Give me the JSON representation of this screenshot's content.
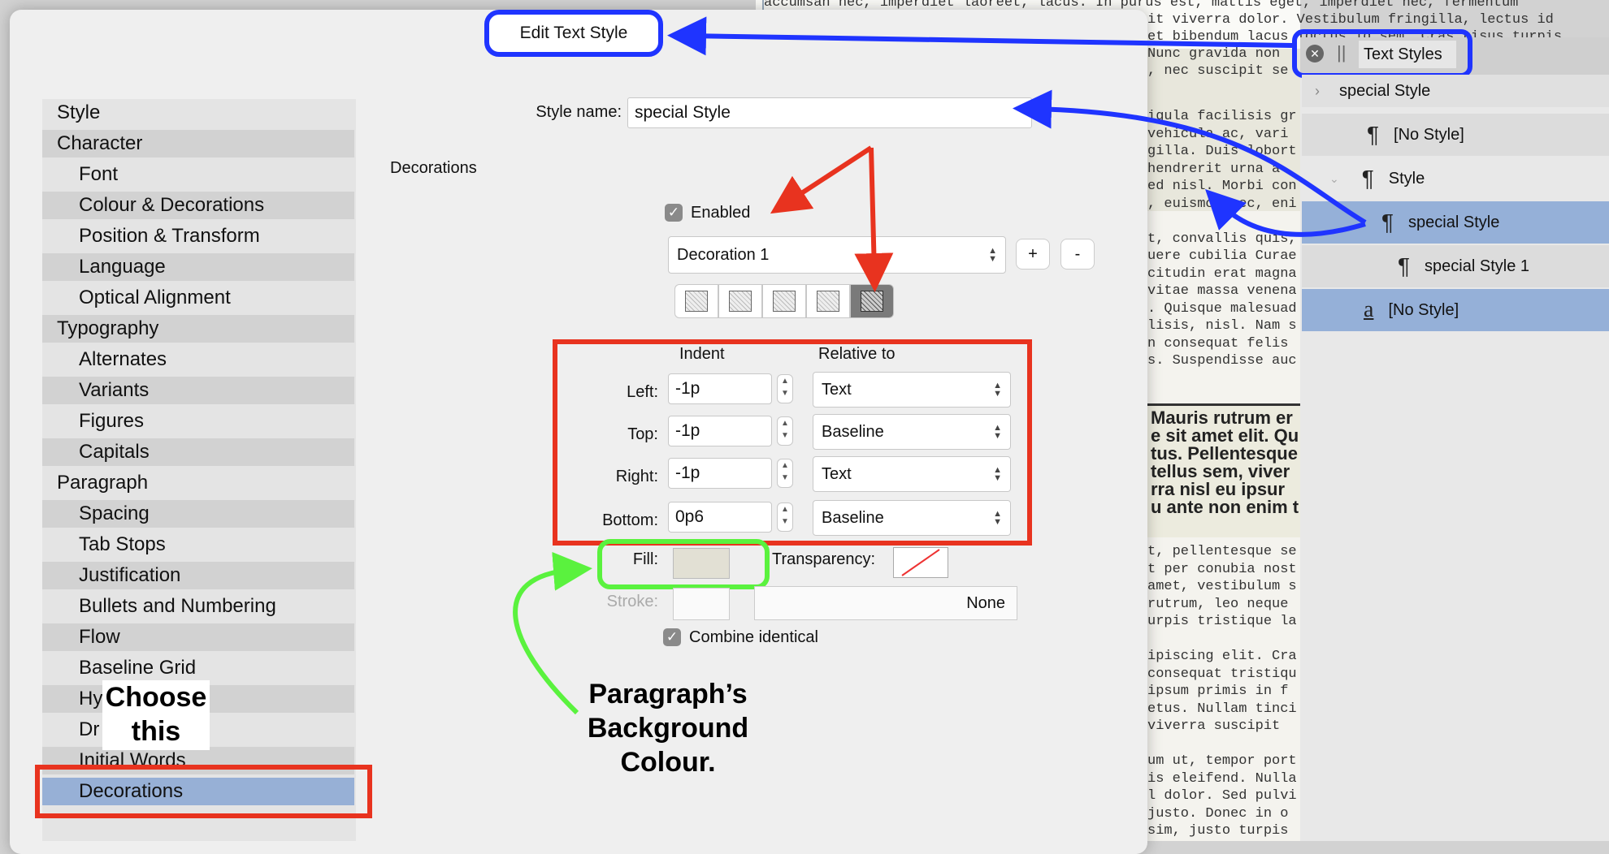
{
  "dialog_title": "Edit Text Style",
  "sidebar": {
    "items": [
      {
        "label": "Style",
        "level": 0
      },
      {
        "label": "Character",
        "level": 0
      },
      {
        "label": "Font",
        "level": 1
      },
      {
        "label": "Colour & Decorations",
        "level": 1
      },
      {
        "label": "Position & Transform",
        "level": 1
      },
      {
        "label": "Language",
        "level": 1
      },
      {
        "label": "Optical Alignment",
        "level": 1
      },
      {
        "label": "Typography",
        "level": 0
      },
      {
        "label": "Alternates",
        "level": 1
      },
      {
        "label": "Variants",
        "level": 1
      },
      {
        "label": "Figures",
        "level": 1
      },
      {
        "label": "Capitals",
        "level": 1
      },
      {
        "label": "Paragraph",
        "level": 0
      },
      {
        "label": "Spacing",
        "level": 1
      },
      {
        "label": "Tab Stops",
        "level": 1
      },
      {
        "label": "Justification",
        "level": 1
      },
      {
        "label": "Bullets and Numbering",
        "level": 1
      },
      {
        "label": "Flow",
        "level": 1
      },
      {
        "label": "Baseline Grid",
        "level": 1
      },
      {
        "label": "Hy",
        "level": 1
      },
      {
        "label": "Dr",
        "level": 1
      },
      {
        "label": "Initial Words",
        "level": 1
      },
      {
        "label": "Decorations",
        "level": 1,
        "selected": true
      }
    ]
  },
  "form": {
    "style_name_label": "Style name:",
    "style_name_value": "special Style",
    "section_label": "Decorations",
    "enabled_label": "Enabled",
    "decoration_select": "Decoration 1",
    "add_label": "+",
    "remove_label": "-",
    "indent_header": "Indent",
    "relative_header": "Relative to",
    "rows": [
      {
        "label": "Left:",
        "indent": "-1p",
        "relative": "Text"
      },
      {
        "label": "Top:",
        "indent": "-1p",
        "relative": "Baseline"
      },
      {
        "label": "Right:",
        "indent": "-1p",
        "relative": "Text"
      },
      {
        "label": "Bottom:",
        "indent": "0p6",
        "relative": "Baseline"
      }
    ],
    "fill_label": "Fill:",
    "transparency_label": "Transparency:",
    "stroke_label": "Stroke:",
    "stroke_value": "None",
    "combine_label": "Combine identical"
  },
  "annotations": {
    "choose_this": "Choose this",
    "paragraph_bg": "Paragraph’s Background Colour."
  },
  "right_panel": {
    "tab_title": "Text Styles",
    "items": [
      {
        "label": "special Style",
        "kind": "header"
      },
      {
        "label": "[No Style]",
        "kind": "para"
      },
      {
        "label": "Style",
        "kind": "para"
      },
      {
        "label": "special Style",
        "kind": "para",
        "selected": true
      },
      {
        "label": "special Style 1",
        "kind": "para"
      },
      {
        "label": "[No Style]",
        "kind": "char",
        "selected": true
      }
    ]
  },
  "document": {
    "top_lines": [
      "accumsan nec, imperdiet laoreet, lacus. In purus est, mattis eget, imperdiet nec, fermentum",
      "it viverra dolor. Vestibulum fringilla, lectus id",
      "et bibendum lacus loctus id sem. Cras risus turpis",
      "Nunc gravida non",
      ", nec suscipit se"
    ],
    "col_lines": [
      "igula facilisis gr",
      " vehicula ac, vari",
      "gilla. Duis lobort",
      "hendrerit urna a",
      "ed nisl. Morbi con",
      ", euismod nec, eni",
      "",
      "t, convallis quis,",
      "uere cubilia Curae",
      "citudin erat magna",
      "vitae massa venena",
      ". Quisque malesuad",
      "lisis, nisl. Nam s",
      "n consequat felis",
      "s. Suspendisse auc"
    ],
    "bold_lines": [
      "Mauris rutrum er",
      "e sit amet elit. Qu",
      "tus. Pellentesque",
      " tellus sem, viver",
      "rra nisl eu ipsur",
      "u ante non enim t"
    ],
    "bottom_lines": [
      "t, pellentesque se",
      "t per conubia nost",
      "amet, vestibulum s",
      "rutrum, leo neque",
      "urpis tristique la",
      "",
      "ipiscing elit. Cra",
      "consequat tristiqu",
      " ipsum primis in f",
      "etus. Nullam tinci",
      " viverra suscipit",
      "",
      "um ut, tempor port",
      "is eleifend. Nulla",
      "l dolor. Sed pulvi",
      " justo. Donec in o",
      "sim, justo turpis"
    ]
  }
}
